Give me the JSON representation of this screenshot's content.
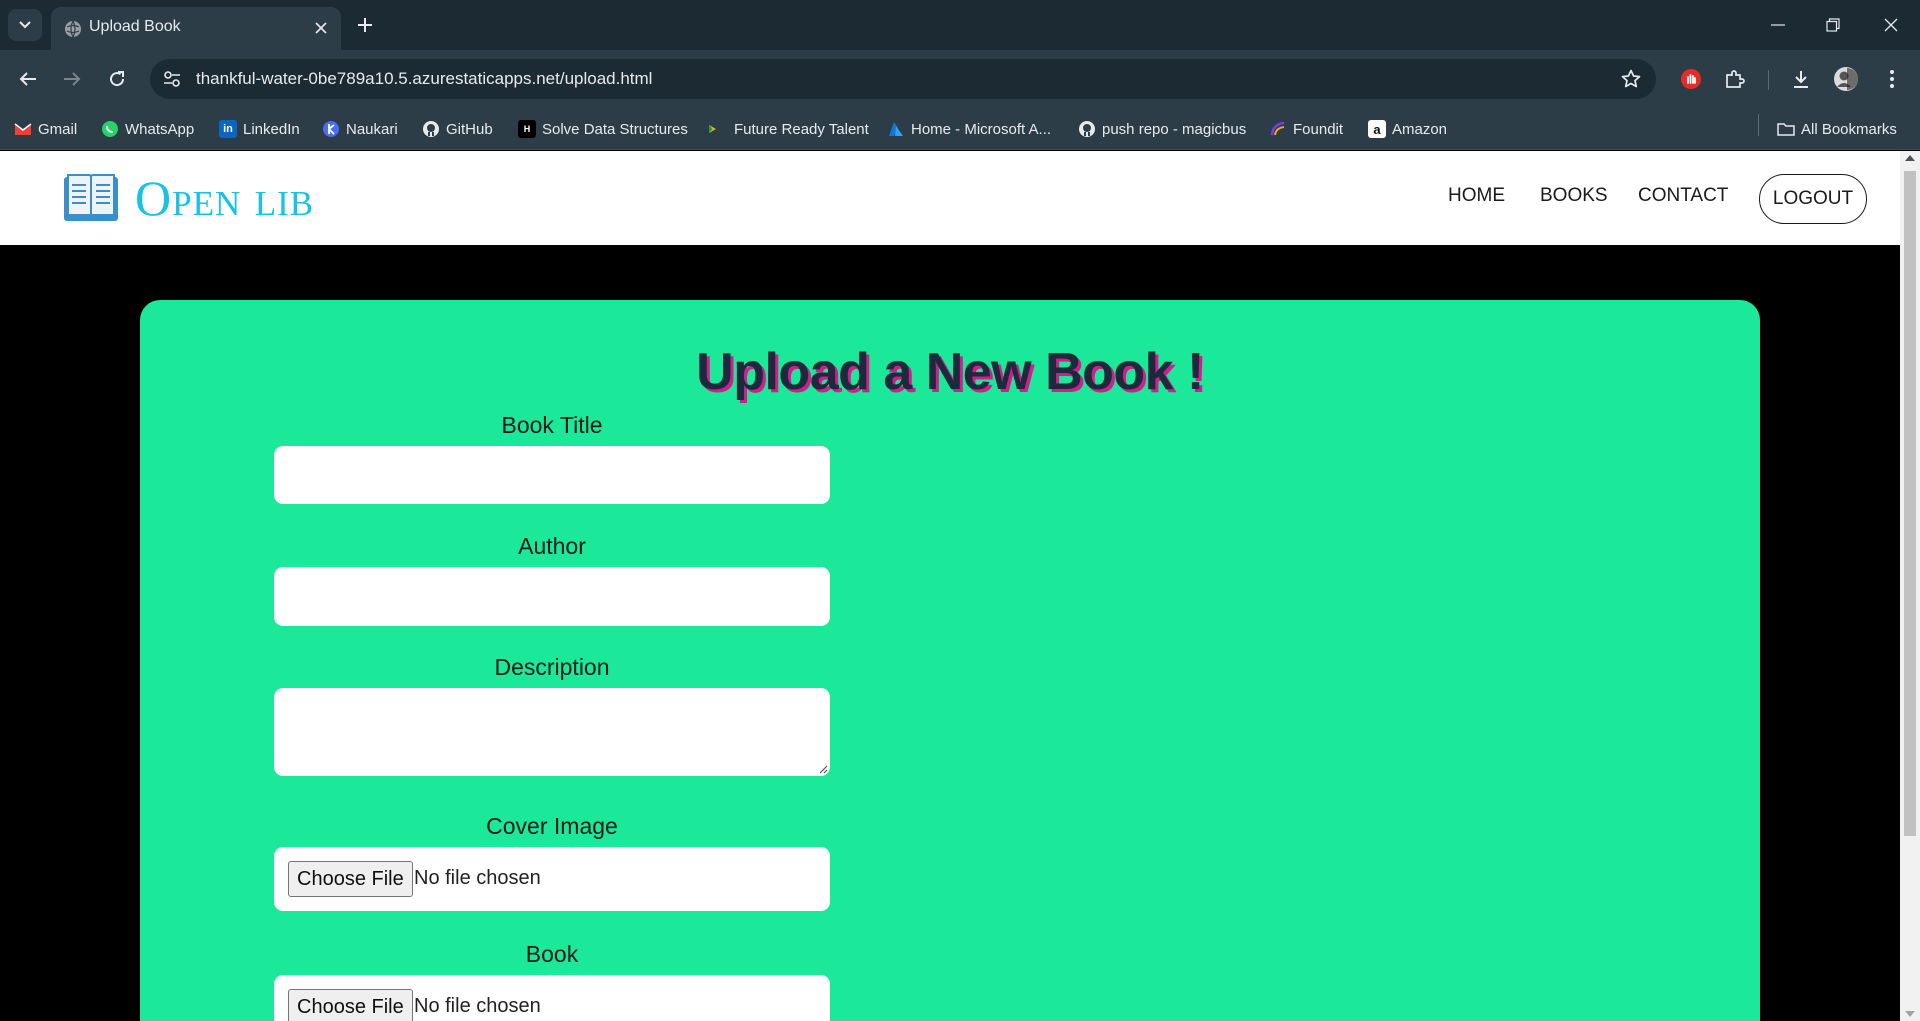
{
  "browser": {
    "tab_title": "Upload Book",
    "url": "thankful-water-0be789a10.5.azurestaticapps.net/upload.html",
    "bookmarks": [
      {
        "label": "Gmail",
        "icon": "gmail-icon"
      },
      {
        "label": "WhatsApp",
        "icon": "whatsapp-icon"
      },
      {
        "label": "LinkedIn",
        "icon": "linkedin-icon"
      },
      {
        "label": "Naukari",
        "icon": "naukari-icon"
      },
      {
        "label": "GitHub",
        "icon": "github-icon"
      },
      {
        "label": "Solve Data Structures",
        "icon": "hackerrank-icon"
      },
      {
        "label": "Future Ready Talent",
        "icon": "play-icon"
      },
      {
        "label": "Home - Microsoft A...",
        "icon": "azure-icon"
      },
      {
        "label": "push repo - magicbus",
        "icon": "github-icon"
      },
      {
        "label": "Foundit",
        "icon": "foundit-icon"
      },
      {
        "label": "Amazon",
        "icon": "amazon-icon"
      }
    ],
    "all_bookmarks": "All Bookmarks"
  },
  "site": {
    "logo_text": "Open lib",
    "nav": {
      "home": "HOME",
      "books": "BOOKS",
      "contact": "CONTACT",
      "logout": "LOGOUT"
    }
  },
  "form": {
    "title": "Upload a New Book !",
    "book_title_label": "Book Title",
    "book_title_value": "",
    "author_label": "Author",
    "author_value": "",
    "description_label": "Description",
    "description_value": "",
    "cover_label": "Cover Image",
    "cover_button": "Choose File",
    "cover_status": "No file chosen",
    "book_label": "Book",
    "book_button": "Choose File",
    "book_status": "No file chosen"
  },
  "colors": {
    "logo": "#17c3e3",
    "card": "#1be899",
    "title_text": "#1c2a3c",
    "title_shadow": "#d61b8f"
  }
}
